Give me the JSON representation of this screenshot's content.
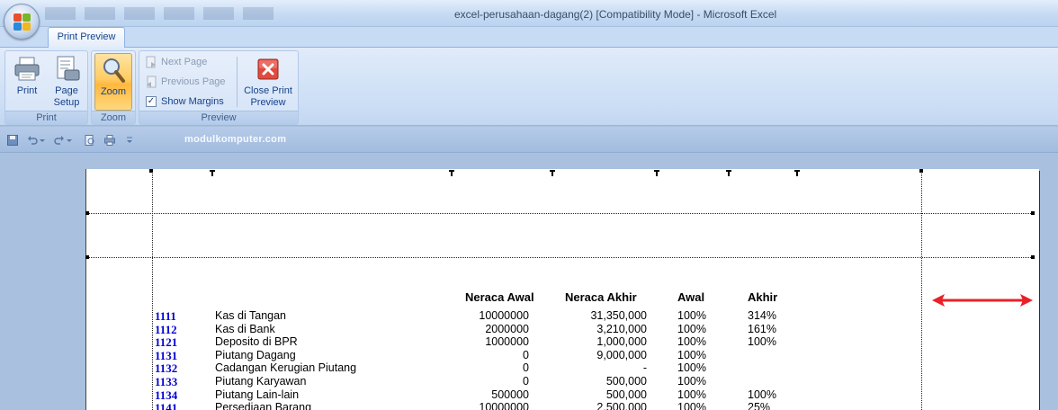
{
  "window": {
    "title": "excel-perusahaan-dagang(2)  [Compatibility Mode] - Microsoft Excel"
  },
  "tabs": [
    {
      "label": "Print Preview",
      "active": true
    }
  ],
  "ribbon": {
    "print_group": {
      "label": "Print",
      "print": "Print",
      "page_setup_1": "Page",
      "page_setup_2": "Setup"
    },
    "zoom_group": {
      "label": "Zoom",
      "zoom": "Zoom",
      "zoom_active": true
    },
    "preview_group": {
      "label": "Preview",
      "next_page": "Next Page",
      "previous_page": "Previous Page",
      "show_margins": "Show Margins",
      "show_margins_checked": true,
      "close_1": "Close Print",
      "close_2": "Preview"
    }
  },
  "qat": {
    "watermark": "modulkomputer.com",
    "icons": [
      "save-icon",
      "undo-icon",
      "redo-icon",
      "print-preview-icon",
      "quick-print-icon",
      "customize-icon"
    ]
  },
  "sheet": {
    "headers": {
      "neraca_awal": "Neraca Awal",
      "neraca_akhir": "Neraca Akhir",
      "awal": "Awal",
      "akhir": "Akhir"
    },
    "rows": [
      {
        "code": "1111",
        "name": "Kas di Tangan",
        "awal": "10000000",
        "akhir": "31,350,000",
        "pct_awal": "100%",
        "pct_akhir": "314%"
      },
      {
        "code": "1112",
        "name": "Kas di Bank",
        "awal": "2000000",
        "akhir": "3,210,000",
        "pct_awal": "100%",
        "pct_akhir": "161%"
      },
      {
        "code": "1121",
        "name": "Deposito di BPR",
        "awal": "1000000",
        "akhir": "1,000,000",
        "pct_awal": "100%",
        "pct_akhir": "100%"
      },
      {
        "code": "1131",
        "name": "Piutang Dagang",
        "awal": "0",
        "akhir": "9,000,000",
        "pct_awal": "100%",
        "pct_akhir": ""
      },
      {
        "code": "1132",
        "name": "Cadangan Kerugian Piutang",
        "awal": "0",
        "akhir": "-",
        "pct_awal": "100%",
        "pct_akhir": ""
      },
      {
        "code": "1133",
        "name": "Piutang Karyawan",
        "awal": "0",
        "akhir": "500,000",
        "pct_awal": "100%",
        "pct_akhir": ""
      },
      {
        "code": "1134",
        "name": "Piutang Lain-lain",
        "awal": "500000",
        "akhir": "500,000",
        "pct_awal": "100%",
        "pct_akhir": "100%"
      },
      {
        "code": "1141",
        "name": "Persediaan Barang",
        "awal": "10000000",
        "akhir": "2,500,000",
        "pct_awal": "100%",
        "pct_akhir": "25%"
      }
    ]
  },
  "colors": {
    "accent_red": "#e8212a",
    "code_blue": "#0000d6",
    "ribbon_bg": "#d4e3f7"
  }
}
